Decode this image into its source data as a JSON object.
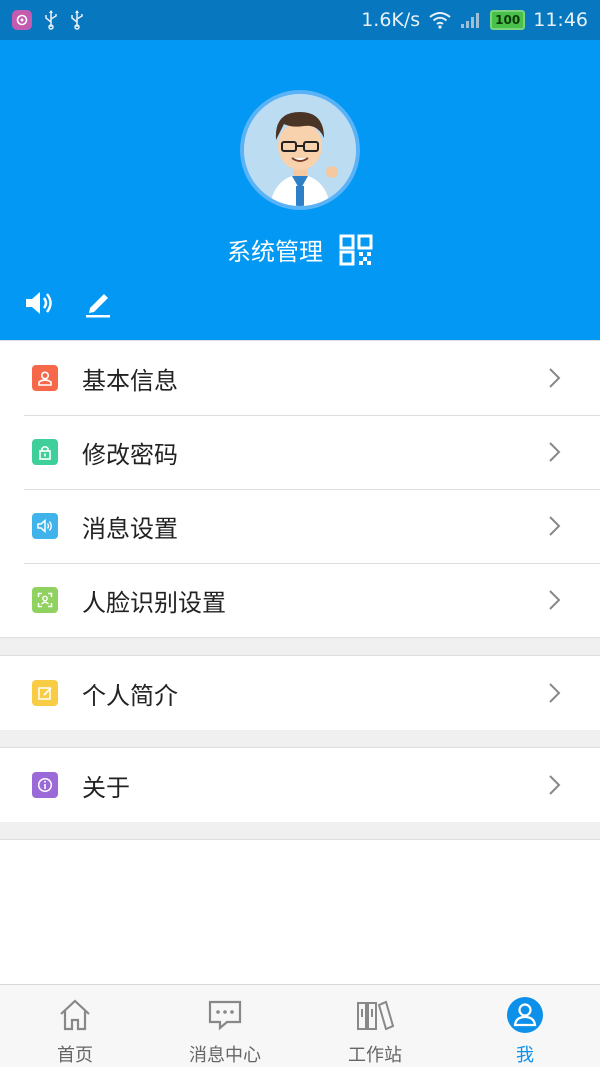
{
  "status_bar": {
    "speed": "1.6K/s",
    "battery": "100",
    "time": "11:46"
  },
  "profile": {
    "username": "系统管理"
  },
  "menu_groups": [
    [
      {
        "label": "基本信息",
        "icon": "user-icon",
        "color": "#f7684b"
      },
      {
        "label": "修改密码",
        "icon": "lock-icon",
        "color": "#3fcf9b"
      },
      {
        "label": "消息设置",
        "icon": "speaker-icon",
        "color": "#3fb3ea"
      },
      {
        "label": "人脸识别设置",
        "icon": "face-scan-icon",
        "color": "#8fd25f"
      }
    ],
    [
      {
        "label": "个人简介",
        "icon": "edit-icon",
        "color": "#f9cc45"
      }
    ],
    [
      {
        "label": "关于",
        "icon": "info-icon",
        "color": "#9b6ad8"
      }
    ]
  ],
  "bottom_nav": {
    "items": [
      {
        "label": "首页",
        "icon": "home-icon"
      },
      {
        "label": "消息中心",
        "icon": "message-icon"
      },
      {
        "label": "工作站",
        "icon": "workstation-icon"
      },
      {
        "label": "我",
        "icon": "profile-icon",
        "active": true
      }
    ]
  },
  "colors": {
    "header": "#0298f3",
    "status_bar": "#0778c0",
    "active": "#0c90ea"
  }
}
